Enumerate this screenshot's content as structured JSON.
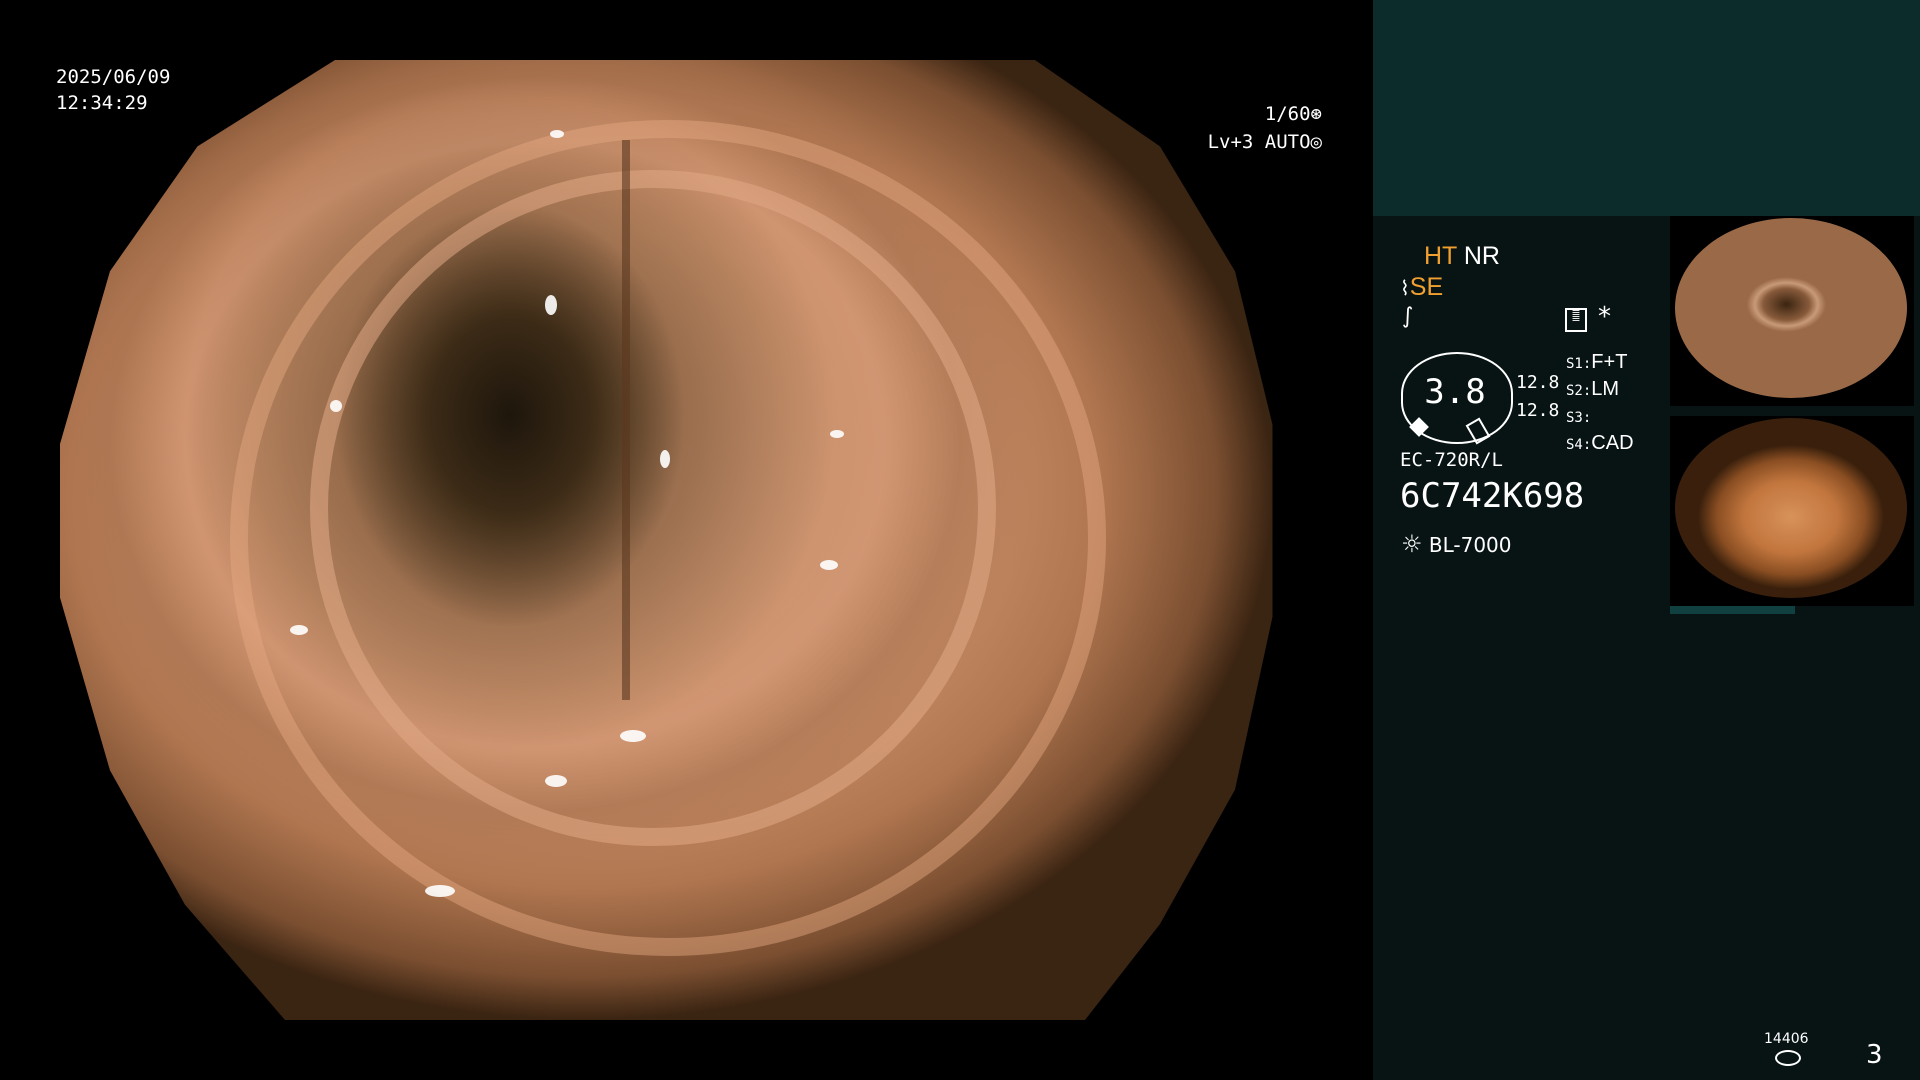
{
  "overlay": {
    "date": "2025/06/09",
    "time": "12:34:29",
    "shutter": "1/60",
    "level": "Lv+3",
    "exposure_mode": "AUTO"
  },
  "panel": {
    "mode_ht": "HT",
    "mode_nr": "NR",
    "mode_se": "SE",
    "gauge_value": "3.8",
    "gauge_top_right": "12.8",
    "gauge_bottom_right": "12.8",
    "switches": [
      {
        "key": "S1:",
        "value": "F+T"
      },
      {
        "key": "S2:",
        "value": "LM"
      },
      {
        "key": "S3:",
        "value": ""
      },
      {
        "key": "S4:",
        "value": "CAD"
      }
    ],
    "scope_model": "EC-720R/L",
    "serial": "6C742K698",
    "light_source": "BL-7000",
    "storage_count": "14406",
    "image_count": "3"
  },
  "colors": {
    "accent_orange": "#f0a030",
    "panel_bg": "#081414",
    "panel_top_bg": "#0c2b2b"
  },
  "icons": [
    "shutter-icon",
    "iris-icon",
    "scope-tip-icon",
    "curve-icon",
    "menu-icon",
    "asterisk-icon",
    "lamp-icon",
    "storage-icon"
  ]
}
